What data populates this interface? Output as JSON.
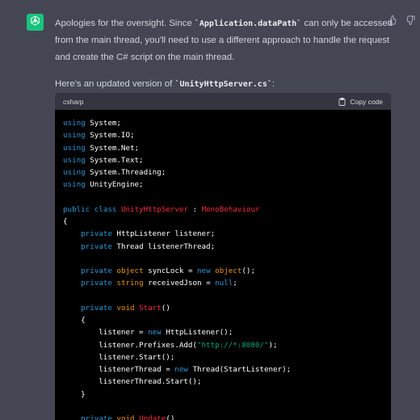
{
  "message": {
    "paragraph1": {
      "before": "Apologies for the oversight. Since ",
      "code": "`Application.dataPath`",
      "after": " can only be accessed from the main thread, you'll need to use a different approach to handle the request and create the C# script on the main thread."
    },
    "paragraph2": {
      "before": "Here's an updated version of ",
      "code": "`UnityHttpServer.cs`",
      "after": ":"
    }
  },
  "codeblock": {
    "language": "csharp",
    "copy_label": "Copy code",
    "lines": [
      [
        [
          "kw",
          "using"
        ],
        [
          "plain",
          " System;"
        ]
      ],
      [
        [
          "kw",
          "using"
        ],
        [
          "plain",
          " System.IO;"
        ]
      ],
      [
        [
          "kw",
          "using"
        ],
        [
          "plain",
          " System.Net;"
        ]
      ],
      [
        [
          "kw",
          "using"
        ],
        [
          "plain",
          " System.Text;"
        ]
      ],
      [
        [
          "kw",
          "using"
        ],
        [
          "plain",
          " System.Threading;"
        ]
      ],
      [
        [
          "kw",
          "using"
        ],
        [
          "plain",
          " UnityEngine;"
        ]
      ],
      [],
      [
        [
          "kw",
          "public"
        ],
        [
          "plain",
          " "
        ],
        [
          "kw",
          "class"
        ],
        [
          "plain",
          " "
        ],
        [
          "cls",
          "UnityHttpServer"
        ],
        [
          "plain",
          " : "
        ],
        [
          "cls",
          "MonoBehaviour"
        ]
      ],
      [
        [
          "plain",
          "{"
        ]
      ],
      [
        [
          "plain",
          "    "
        ],
        [
          "kw",
          "private"
        ],
        [
          "plain",
          " HttpListener listener;"
        ]
      ],
      [
        [
          "plain",
          "    "
        ],
        [
          "kw",
          "private"
        ],
        [
          "plain",
          " Thread listenerThread;"
        ]
      ],
      [],
      [
        [
          "plain",
          "    "
        ],
        [
          "kw",
          "private"
        ],
        [
          "plain",
          " "
        ],
        [
          "ty",
          "object"
        ],
        [
          "plain",
          " syncLock = "
        ],
        [
          "kw",
          "new"
        ],
        [
          "plain",
          " "
        ],
        [
          "ty",
          "object"
        ],
        [
          "plain",
          "();"
        ]
      ],
      [
        [
          "plain",
          "    "
        ],
        [
          "kw",
          "private"
        ],
        [
          "plain",
          " "
        ],
        [
          "ty",
          "string"
        ],
        [
          "plain",
          " receivedJson = "
        ],
        [
          "kw",
          "null"
        ],
        [
          "plain",
          ";"
        ]
      ],
      [],
      [
        [
          "plain",
          "    "
        ],
        [
          "kw",
          "private"
        ],
        [
          "plain",
          " "
        ],
        [
          "ty",
          "void"
        ],
        [
          "plain",
          " "
        ],
        [
          "cls",
          "Start"
        ],
        [
          "plain",
          "()"
        ]
      ],
      [
        [
          "plain",
          "    {"
        ]
      ],
      [
        [
          "plain",
          "        listener = "
        ],
        [
          "kw",
          "new"
        ],
        [
          "plain",
          " HttpListener();"
        ]
      ],
      [
        [
          "plain",
          "        listener.Prefixes.Add("
        ],
        [
          "str",
          "\"http://*:8080/\""
        ],
        [
          "plain",
          ");"
        ]
      ],
      [
        [
          "plain",
          "        listener.Start();"
        ]
      ],
      [
        [
          "plain",
          "        listenerThread = "
        ],
        [
          "kw",
          "new"
        ],
        [
          "plain",
          " Thread(StartListener);"
        ]
      ],
      [
        [
          "plain",
          "        listenerThread.Start();"
        ]
      ],
      [
        [
          "plain",
          "    }"
        ]
      ],
      [],
      [
        [
          "plain",
          "    "
        ],
        [
          "kw",
          "private"
        ],
        [
          "plain",
          " "
        ],
        [
          "ty",
          "void"
        ],
        [
          "plain",
          " "
        ],
        [
          "cls",
          "Update"
        ],
        [
          "plain",
          "()"
        ]
      ]
    ]
  },
  "icons": {
    "avatar": "openai-logo-icon",
    "thumbs_up": "thumbs-up-icon",
    "thumbs_down": "thumbs-down-icon",
    "copy": "clipboard-icon"
  },
  "colors": {
    "background": "#444654",
    "avatar_bg": "#19c37d",
    "code_bg": "#000000",
    "code_header_bg": "#343541",
    "keyword": "#2e95d3",
    "type": "#e9950c",
    "class_name": "#f22c3d",
    "string": "#00a67d"
  }
}
